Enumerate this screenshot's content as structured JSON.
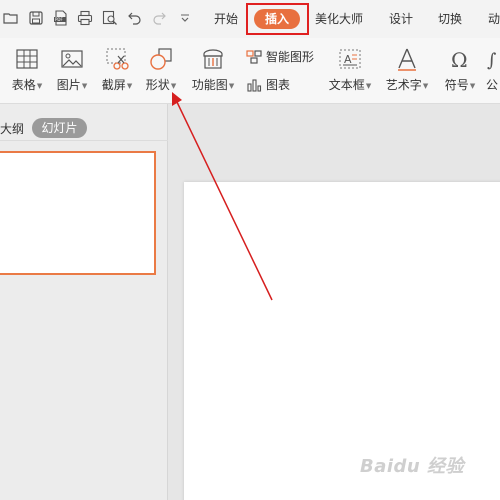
{
  "quick_access": {
    "icons": [
      "open-folder-icon",
      "save-icon",
      "export-pdf-icon",
      "print-icon",
      "print-preview-icon",
      "undo-icon",
      "redo-icon",
      "customize-chevron-icon"
    ]
  },
  "menu_tabs": {
    "start": "开始",
    "insert": "插入",
    "beautify": "美化大师",
    "design": "设计",
    "transition": "切换",
    "animation": "动"
  },
  "ribbon": {
    "table": "表格",
    "picture": "图片",
    "screenshot": "截屏",
    "shape": "形状",
    "function_chart": "功能图",
    "smart_graphic": "智能图形",
    "chart": "图表",
    "textbox": "文本框",
    "wordart": "艺术字",
    "symbol": "符号",
    "formula": "公"
  },
  "left_panel": {
    "outline_tab": "大纲",
    "slides_tab": "幻灯片"
  },
  "colors": {
    "accent": "#e8703f",
    "highlight_box": "#e02020",
    "annotation_arrow": "#d61f1f"
  },
  "watermark": "Baidu 经验"
}
